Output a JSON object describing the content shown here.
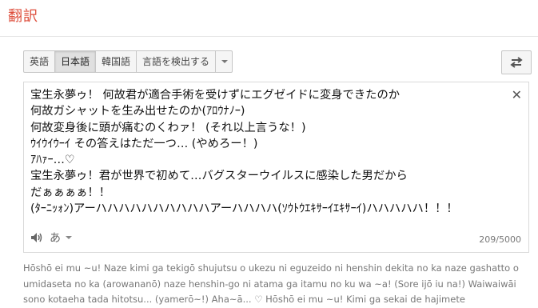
{
  "header": {
    "title": "翻訳"
  },
  "language_tabs": [
    {
      "label": "英語",
      "active": false
    },
    {
      "label": "日本語",
      "active": true
    },
    {
      "label": "韓国語",
      "active": false
    },
    {
      "label": "言語を検出する",
      "active": false
    }
  ],
  "source": {
    "text": "宝生永夢ゥ！ 何故君が適合手術を受けずにエグゼイドに変身できたのか\n何故ガシャットを生み出せたのか(ｱﾛｳﾅﾉｰ)\n何故変身後に頭が痛むのくわァ！ (それ以上言うな！)\nｳｲｳｲｳｰｲ その答えはただ一つ… (やめろー！)\nｱﾊｧｰ…♡\n宝生永夢ゥ！君が世界で初めて…バグスターウイルスに感染した男だから\nだぁぁぁぁ！！\n(ﾀｰﾆｯｫﾝ)アーハハハハハハハハハハアーハハハハ(ｿｳﾄｳｴｷｻｰｲｴｷｻｰｲ)ハハハハハ！！！",
    "input_tool_label": "あ",
    "char_count": "209/5000"
  },
  "romanization": {
    "text": "Hōshō ei mu ~u! Naze kimi ga tekigō shujutsu o ukezu ni eguzeido ni henshin dekita no ka naze gashatto o\numidaseta no ka (arowananō) naze henshin-go ni atama ga itamu no ku wa ~a! (Sore ijō iu na!) Waiwaiwāi\nsono kotaeha tada hitotsu... (yamerō~!) Aha~ā... ♡ Hōshō ei mu ~u! Kimi ga sekai de hajimete"
  },
  "colors": {
    "title": "#dd4b39",
    "border": "#c6c6c6"
  }
}
